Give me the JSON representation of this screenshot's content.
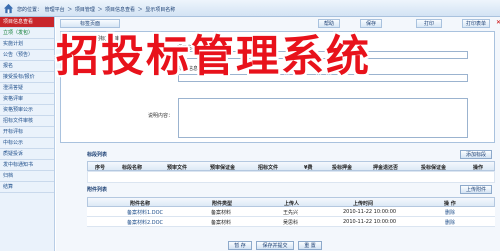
{
  "breadcrumb": {
    "location_prefix": "您的位置：",
    "items": [
      "管理平台",
      "项目管理",
      "项目信息查看",
      "显示项目名称"
    ],
    "separator": "＞"
  },
  "sidebar": {
    "items": [
      {
        "label": "项目信息查看"
      },
      {
        "label": "立项（发包）"
      },
      {
        "label": "实施计划"
      },
      {
        "label": "公告（预告）"
      },
      {
        "label": "报名"
      },
      {
        "label": "接受投标/报价"
      },
      {
        "label": "澄清答疑"
      },
      {
        "label": "资格评审"
      },
      {
        "label": "资格预审公示"
      },
      {
        "label": "招标文件审核"
      },
      {
        "label": "开标评标"
      },
      {
        "label": "中标公示"
      },
      {
        "label": "质疑投诉"
      },
      {
        "label": "发中标通知书"
      },
      {
        "label": "归档"
      },
      {
        "label": "结算"
      }
    ]
  },
  "banner": {
    "text": "招投标管理系统"
  },
  "tabs": {
    "form_tab": "标签页面",
    "help": "帮助",
    "save": "保存",
    "print": "打印",
    "print_form": "打印表单"
  },
  "form": {
    "section_title": "招标文件审核",
    "project_name_label": "项目名称内容",
    "section_label": "标段信息",
    "description_label": "说明内容："
  },
  "bid_sections": {
    "title": "标段列表",
    "add_button": "添加标段",
    "columns": [
      "序号",
      "标段名称",
      "预审文件",
      "预审保证金",
      "招标文件",
      "¥费",
      "投标押金",
      "押金退还否",
      "投标保证金",
      "操作"
    ]
  },
  "attachments": {
    "title": "附件列表",
    "upload_button": "上传附件",
    "columns": [
      "附件名称",
      "附件类型",
      "上传人",
      "上传时间",
      "操 作"
    ],
    "rows": [
      {
        "name": "备案材料1.DOC",
        "type": "备案材料",
        "uploader": "王先兴",
        "time": "2010-11-22 10:00:00",
        "action": "删除"
      },
      {
        "name": "备案材料2.DOC",
        "type": "备案材料",
        "uploader": "吴思科",
        "time": "2010-11-22 10:00:00",
        "action": "删除"
      }
    ]
  },
  "footer_buttons": {
    "save": "暂 存",
    "submit": "保存并提交",
    "reset": "重 置"
  },
  "colors": {
    "accent_red": "#e8121b",
    "active_sidebar": "#c8262b",
    "link_blue": "#1d4d8a"
  }
}
